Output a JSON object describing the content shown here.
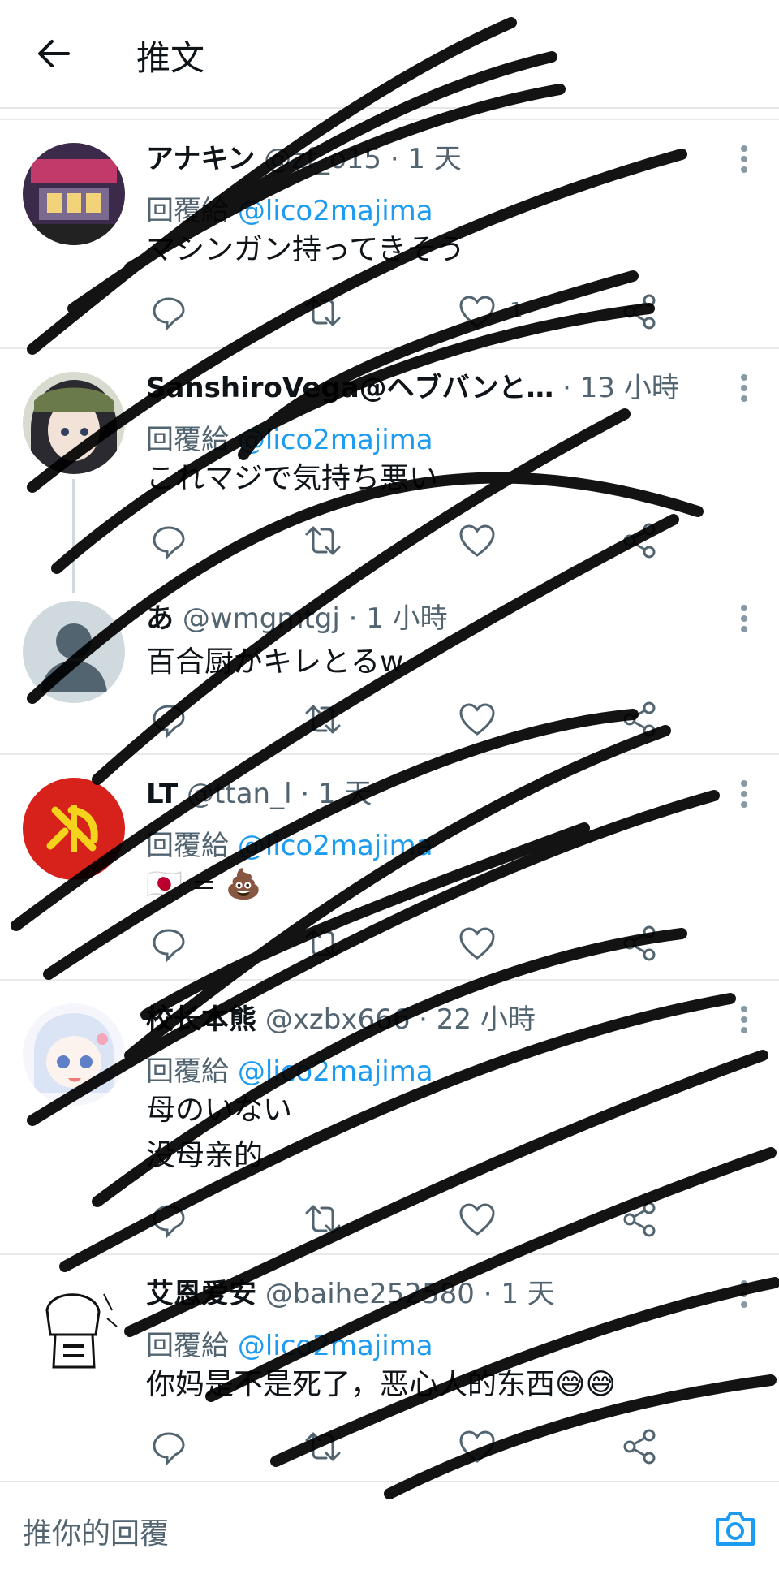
{
  "header": {
    "back_icon": "back-arrow-icon",
    "title": "推文"
  },
  "tweets": [
    {
      "name": "アナキン",
      "meta": "@zf_o15 · 1 天",
      "reply_prefix": "回覆給",
      "reply_handle": "@lico2majima",
      "lines": [
        "マシンガン持ってきそう"
      ],
      "like_count": "1"
    },
    {
      "name": "SanshiroVega@ヘブバンと…",
      "meta": "· 13 小時",
      "reply_prefix": "回覆給",
      "reply_handle": "@lico2majima",
      "lines": [
        "これマジで気持ち悪い"
      ]
    },
    {
      "name": "あ",
      "meta": "@wmgmtgj · 1 小時",
      "lines": [
        "百合厨がキレとるw"
      ]
    },
    {
      "name": "LT",
      "meta": "@ttan_l · 1 天",
      "reply_prefix": "回覆給",
      "reply_handle": "@lico2majima",
      "lines": [
        "🇯🇵 = 💩"
      ]
    },
    {
      "name": "校长本熊",
      "meta": "@xzbx666 · 22 小時",
      "reply_prefix": "回覆給",
      "reply_handle": "@lico2majima",
      "lines": [
        "母のいない",
        "没母亲的"
      ]
    },
    {
      "name": "艾恩爱安",
      "meta": "@baihe252580 · 1 天",
      "reply_prefix": "回覆給",
      "reply_handle": "@lico2majima",
      "lines": [
        "你妈是不是死了，恶心人的东西😅😅"
      ]
    }
  ],
  "composer": {
    "placeholder": "推你的回覆",
    "camera_icon": "camera-icon"
  },
  "colors": {
    "link": "#1d9bf0",
    "secondary": "#536471",
    "divider": "#eaeaea",
    "scribble": "#000000"
  }
}
